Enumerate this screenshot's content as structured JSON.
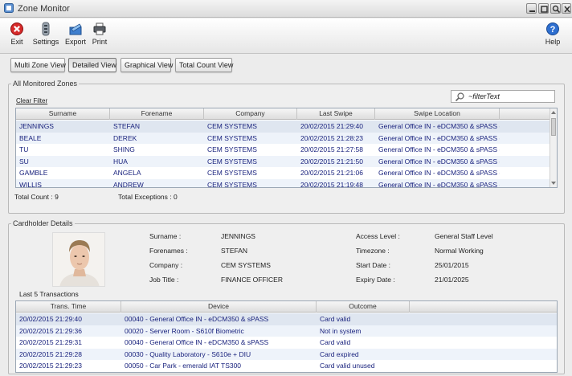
{
  "window": {
    "title": "Zone Monitor"
  },
  "toolbar": {
    "exit_label": "Exit",
    "settings_label": "Settings",
    "export_label": "Export",
    "print_label": "Print",
    "help_label": "Help"
  },
  "view_tabs": [
    {
      "label": "Multi Zone View",
      "active": false
    },
    {
      "label": "Detailed View",
      "active": true
    },
    {
      "label": "Graphical View",
      "active": false
    },
    {
      "label": "Total Count View",
      "active": false
    }
  ],
  "monitored": {
    "group_title": "All Monitored Zones",
    "clear_filter_label": "Clear Filter",
    "filter_value": "~filterText",
    "columns": [
      "Surname",
      "Forename",
      "Company",
      "Last Swipe",
      "Swipe Location"
    ],
    "rows": [
      [
        "JENNINGS",
        "STEFAN",
        "CEM SYSTEMS",
        "20/02/2015 21:29:40",
        "General Office IN - eDCM350 & sPASS ("
      ],
      [
        "BEALE",
        "DEREK",
        "CEM SYSTEMS",
        "20/02/2015 21:28:23",
        "General Office IN - eDCM350 & sPASS ("
      ],
      [
        "TU",
        "SHING",
        "CEM SYSTEMS",
        "20/02/2015 21:27:58",
        "General Office IN - eDCM350 & sPASS ("
      ],
      [
        "SU",
        "HUA",
        "CEM SYSTEMS",
        "20/02/2015 21:21:50",
        "General Office IN - eDCM350 & sPASS ("
      ],
      [
        "GAMBLE",
        "ANGELA",
        "CEM SYSTEMS",
        "20/02/2015 21:21:06",
        "General Office IN - eDCM350 & sPASS ("
      ],
      [
        "WILLIS",
        "ANDREW",
        "CEM SYSTEMS",
        "20/02/2015 21:19:48",
        "General Office IN - eDCM350 & sPASS ("
      ]
    ],
    "total_count_label": "Total Count : 9",
    "total_exceptions_label": "Total Exceptions : 0"
  },
  "cardholder": {
    "group_title": "Cardholder Details",
    "surname_label": "Surname :",
    "surname_value": "JENNINGS",
    "forenames_label": "Forenames :",
    "forenames_value": "STEFAN",
    "company_label": "Company :",
    "company_value": "CEM SYSTEMS",
    "jobtitle_label": "Job Title :",
    "jobtitle_value": "FINANCE OFFICER",
    "access_label": "Access Level :",
    "access_value": "General Staff Level",
    "timezone_label": "Timezone :",
    "timezone_value": "Normal Working",
    "start_label": "Start Date :",
    "start_value": "25/01/2015",
    "expiry_label": "Expiry Date :",
    "expiry_value": "21/01/2025"
  },
  "transactions": {
    "title": "Last 5 Transactions",
    "columns": [
      "Trans. Time",
      "Device",
      "Outcome"
    ],
    "rows": [
      [
        "20/02/2015 21:29:40",
        "00040 - General Office IN - eDCM350 & sPASS",
        "Card valid"
      ],
      [
        "20/02/2015 21:29:36",
        "00020 - Server Room - S610f Biometric",
        "Not in system"
      ],
      [
        "20/02/2015 21:29:31",
        "00040 - General Office IN - eDCM350 & sPASS",
        "Card valid"
      ],
      [
        "20/02/2015 21:29:28",
        "00030 - Quality Laboratory - S610e + DIU",
        "Card expired"
      ],
      [
        "20/02/2015 21:29:23",
        "00050 - Car Park - emerald IAT TS300",
        "Card valid unused"
      ]
    ]
  },
  "colors": {
    "row_text": "#1a237e",
    "alt_row": "#eef3fa",
    "selected_row": "#dfe6f0"
  },
  "icons": [
    "app-icon",
    "exit-icon",
    "settings-icon",
    "export-icon",
    "print-icon",
    "help-icon",
    "search-icon"
  ]
}
